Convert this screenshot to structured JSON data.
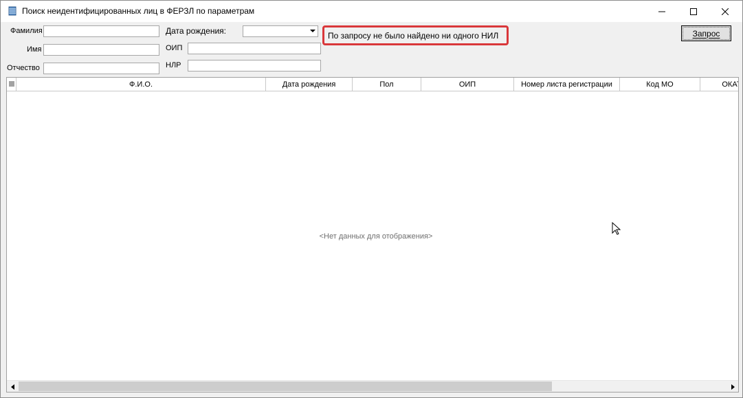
{
  "window": {
    "title": "Поиск неидентифицированных лиц в ФЕРЗЛ по параметрам",
    "icon": "database-icon",
    "buttons": [
      "minimize-icon",
      "maximize-icon",
      "close-icon"
    ]
  },
  "form": {
    "surname_label": "Фамилия",
    "surname_value": "",
    "name_label": "Имя",
    "name_value": "",
    "patronymic_label": "Отчество",
    "patronymic_value": "",
    "birthdate_label": "Дата рождения:",
    "birthdate_value": "",
    "oip_label": "ОИП",
    "oip_value": "",
    "nlr_label": "НЛР",
    "nlr_value": "",
    "message": "По запросу не было найдено ни одного НИЛ",
    "query_button": "Запрос"
  },
  "grid": {
    "columns": [
      "Ф.И.О.",
      "Дата рождения",
      "Пол",
      "ОИП",
      "Номер листа регистрации",
      "Код МО",
      "ОКАТО"
    ],
    "empty_text": "<Нет данных для отображения>"
  },
  "colors": {
    "highlight_border": "#d9373a",
    "window_bg": "#f0f0f0"
  }
}
